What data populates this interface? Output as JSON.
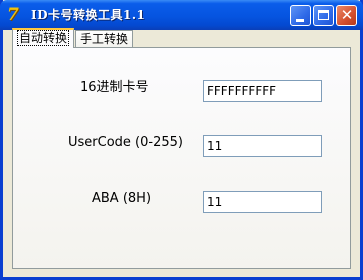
{
  "window": {
    "title": "ID卡号转换工具1.1",
    "icon_glyph": "7"
  },
  "titlebar_buttons": {
    "close_glyph": "✕"
  },
  "tabs": [
    {
      "label": "自动转换",
      "active": true
    },
    {
      "label": "手工转换",
      "active": false
    }
  ],
  "fields": {
    "hex_card": {
      "label": "16进制卡号",
      "value": "FFFFFFFFFF"
    },
    "user_code": {
      "label": "UserCode (0-255)",
      "value": "11"
    },
    "aba": {
      "label": "ABA (8H)",
      "value": "11"
    }
  },
  "colors": {
    "titlebar": "#0A5DEA",
    "window_bg": "#ECE9D8",
    "active_tab_accent": "#FFC83C"
  }
}
